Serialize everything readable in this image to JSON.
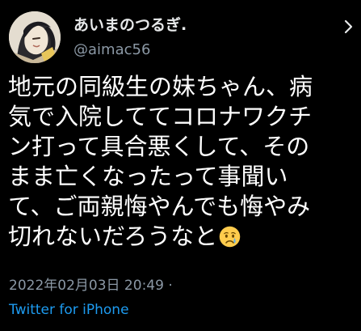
{
  "tweet": {
    "display_name": "あいまのつるぎ.",
    "handle": "@aimac56",
    "body_lines": [
      "地元の同級生の妹ちゃん、病",
      "気で入院しててコロナワクチ",
      "ン打って具合悪くして、その",
      "まま亡くなったって事聞い",
      "て、ご両親悔やんでも悔やみ",
      "切れないだろうなと"
    ],
    "emoji": "crying-face",
    "timestamp": "2022年02月03日 20:49 ·",
    "source": "Twitter for iPhone"
  },
  "colors": {
    "background": "#000000",
    "text": "#ffffff",
    "secondary": "#8b98a5",
    "link": "#1d9bf0"
  }
}
